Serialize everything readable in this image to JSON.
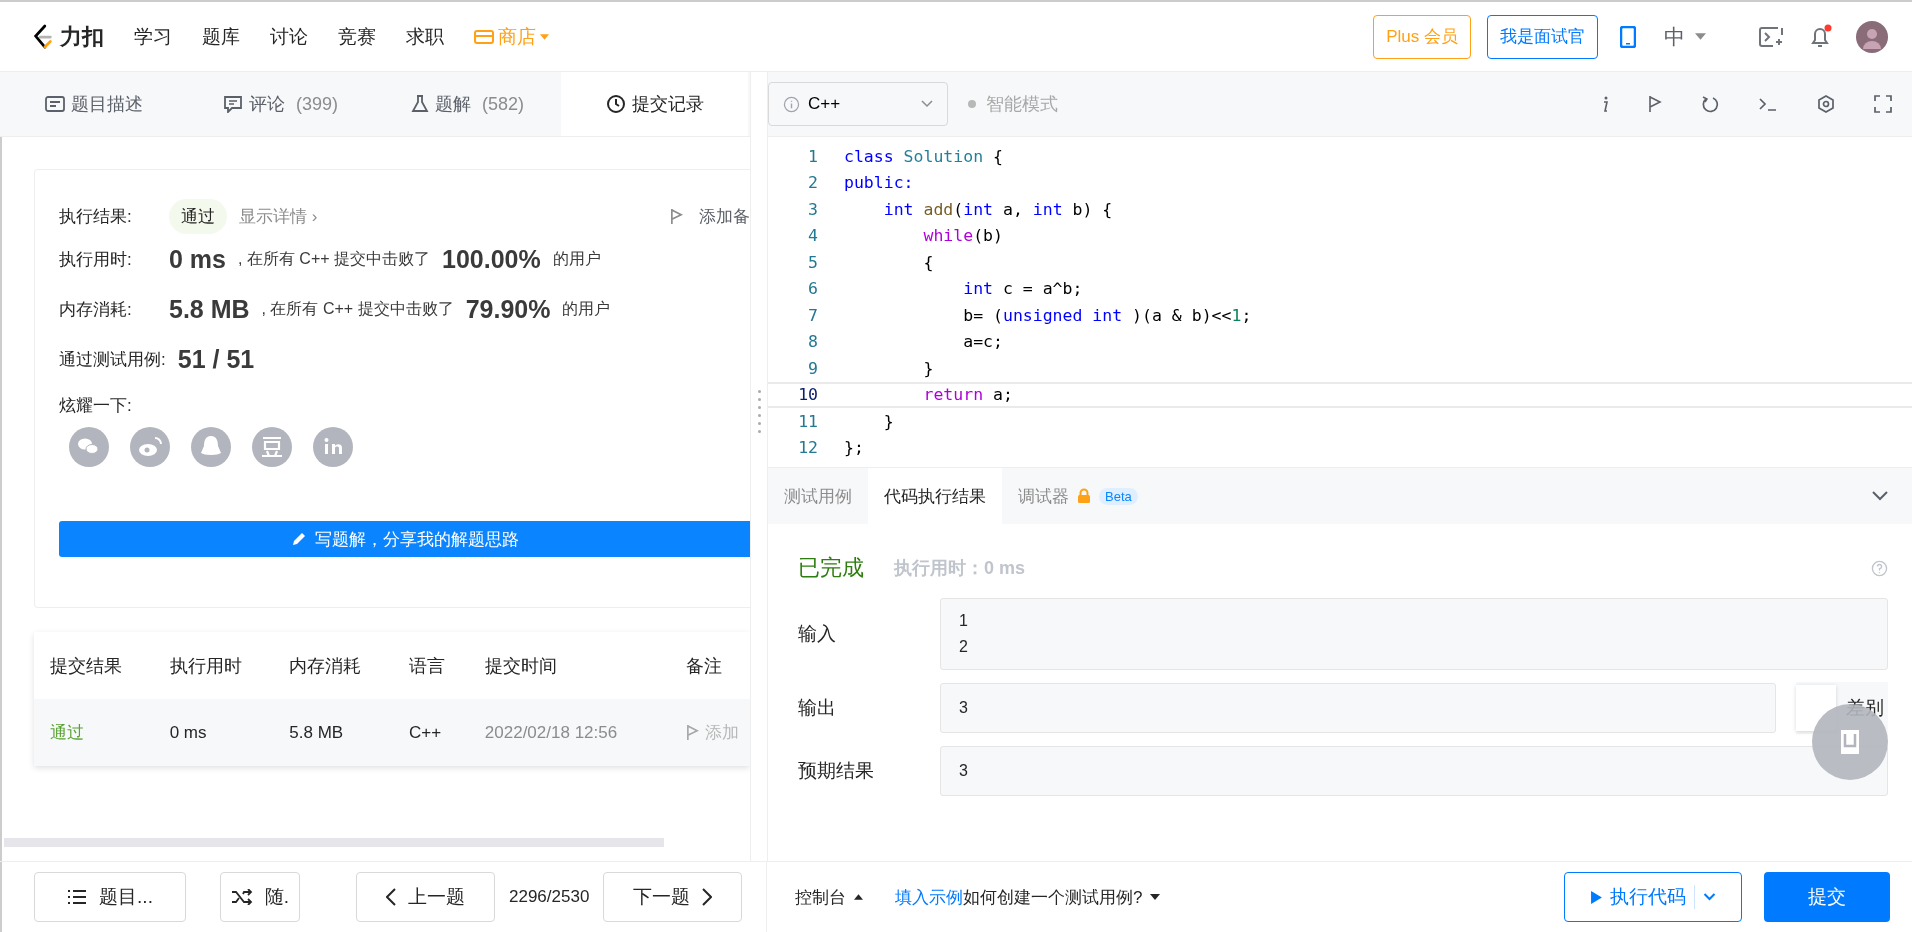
{
  "nav": {
    "logo": "力扣",
    "links": [
      "学习",
      "题库",
      "讨论",
      "竞赛",
      "求职"
    ],
    "shop": "商店",
    "plus": "Plus 会员",
    "interviewer": "我是面试官",
    "lang": "中",
    "has_unread": true
  },
  "left_tabs": [
    {
      "label": "题目描述",
      "selected": false
    },
    {
      "label": "评论",
      "count": "(399)",
      "selected": false
    },
    {
      "label": "题解",
      "count": "(582)",
      "selected": false
    },
    {
      "label": "提交记录",
      "selected": true
    }
  ],
  "result": {
    "label": "执行结果:",
    "status": "通过",
    "details": "显示详情 ›",
    "note": "添加备",
    "time_label": "执行用时:",
    "time": "0 ms",
    "time_text": ", 在所有 C++ 提交中击败了",
    "time_pct": "100.00%",
    "time_tail": "的用户",
    "mem_label": "内存消耗:",
    "mem": "5.8 MB",
    "mem_text": ", 在所有 C++ 提交中击败了",
    "mem_pct": "79.90%",
    "mem_tail": "的用户",
    "cases_label": "通过测试用例:",
    "cases": "51 / 51",
    "share_label": "炫耀一下:",
    "write": "写题解，分享我的解题思路"
  },
  "table": {
    "columns": [
      "提交结果",
      "执行用时",
      "内存消耗",
      "语言",
      "提交时间",
      "备注"
    ],
    "rows": [
      {
        "kind": "accepted",
        "cells": [
          "通过",
          "0 ms",
          "5.8 MB",
          "C++",
          "2022/02/18 12:56",
          "添加"
        ]
      }
    ]
  },
  "editor": {
    "language": "C++",
    "mode": "智能模式",
    "lines": [
      {
        "number": "1",
        "current": false,
        "tokens": [
          {
            "text": "class ",
            "kind": "keyword"
          },
          {
            "text": "Solution",
            "kind": "class"
          },
          {
            "text": " {",
            "kind": "plain"
          }
        ]
      },
      {
        "number": "2",
        "current": false,
        "tokens": [
          {
            "text": "public:",
            "kind": "keyword"
          }
        ]
      },
      {
        "number": "3",
        "current": false,
        "tokens": [
          {
            "text": "    int ",
            "kind": "keyword"
          },
          {
            "text": "add",
            "kind": "function"
          },
          {
            "text": "(",
            "kind": "plain"
          },
          {
            "text": "int ",
            "kind": "keyword"
          },
          {
            "text": "a, ",
            "kind": "plain"
          },
          {
            "text": "int ",
            "kind": "keyword"
          },
          {
            "text": "b) {",
            "kind": "plain"
          }
        ]
      },
      {
        "number": "4",
        "current": false,
        "tokens": [
          {
            "text": "        while",
            "kind": "control"
          },
          {
            "text": "(b)",
            "kind": "plain"
          }
        ]
      },
      {
        "number": "5",
        "current": false,
        "tokens": [
          {
            "text": "        {",
            "kind": "plain"
          }
        ]
      },
      {
        "number": "6",
        "current": false,
        "tokens": [
          {
            "text": "            int ",
            "kind": "keyword"
          },
          {
            "text": "c = a^b;",
            "kind": "plain"
          }
        ]
      },
      {
        "number": "7",
        "current": false,
        "tokens": [
          {
            "text": "            b= (",
            "kind": "plain"
          },
          {
            "text": "unsigned int ",
            "kind": "keyword"
          },
          {
            "text": ")(a & b)<<",
            "kind": "plain"
          },
          {
            "text": "1",
            "kind": "number"
          },
          {
            "text": ";",
            "kind": "plain"
          }
        ]
      },
      {
        "number": "8",
        "current": false,
        "tokens": [
          {
            "text": "            a=c;",
            "kind": "plain"
          }
        ]
      },
      {
        "number": "9",
        "current": false,
        "tokens": [
          {
            "text": "        }",
            "kind": "plain"
          }
        ]
      },
      {
        "number": "10",
        "current": true,
        "tokens": [
          {
            "text": "        return ",
            "kind": "control"
          },
          {
            "text": "a;",
            "kind": "plain"
          }
        ]
      },
      {
        "number": "11",
        "current": false,
        "tokens": [
          {
            "text": "    }",
            "kind": "plain"
          }
        ]
      },
      {
        "number": "12",
        "current": false,
        "tokens": [
          {
            "text": "};",
            "kind": "plain"
          }
        ]
      }
    ]
  },
  "console_tabs": [
    {
      "label": "测试用例",
      "selected": false
    },
    {
      "label": "代码执行结果",
      "selected": true
    },
    {
      "label": "调试器",
      "selected": false,
      "badge": "Beta"
    }
  ],
  "run": {
    "status": "已完成",
    "time": "执行用时：0 ms",
    "input_label": "输入",
    "input": [
      "1",
      "2"
    ],
    "output_label": "输出",
    "output": "3",
    "diff": {
      "label": "差别",
      "on": false
    },
    "expected_label": "预期结果",
    "expected": "3"
  },
  "bottom": {
    "list": "题目...",
    "random": "随.",
    "prev": "上一题",
    "progress": "2296/2530",
    "next": "下一题",
    "console": "控制台",
    "fill": "填入示例",
    "howto": "如何创建一个测试用例?",
    "run": "执行代码",
    "submit": "提交"
  }
}
